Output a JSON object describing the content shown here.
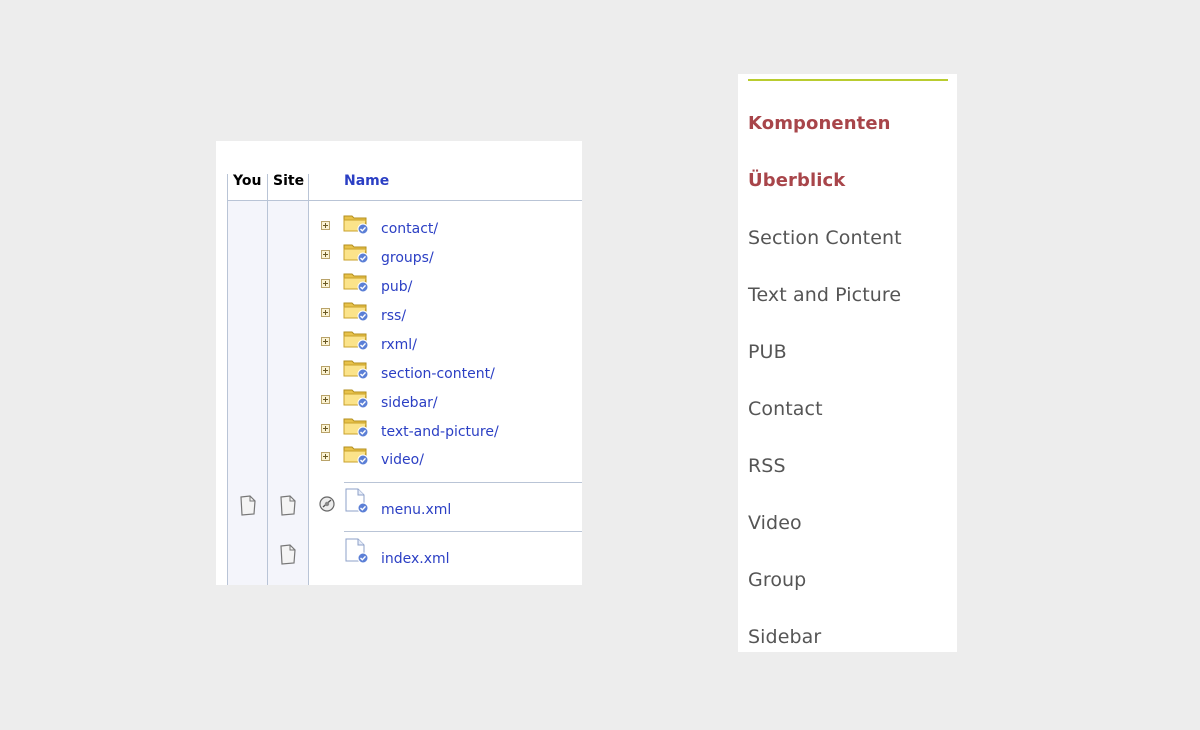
{
  "file_browser": {
    "headers": {
      "you": "You",
      "site": "Site",
      "name": "Name"
    },
    "folders": [
      {
        "name": "contact/"
      },
      {
        "name": "groups/"
      },
      {
        "name": "pub/"
      },
      {
        "name": "rss/"
      },
      {
        "name": "rxml/"
      },
      {
        "name": "section-content/"
      },
      {
        "name": "sidebar/"
      },
      {
        "name": "text-and-picture/"
      },
      {
        "name": "video/"
      }
    ],
    "files": [
      {
        "name": "menu.xml",
        "you_icon": "page-icon",
        "site_icon": "page-icon",
        "status_icon": "eye-icon"
      },
      {
        "name": "index.xml",
        "site_icon": "page-icon"
      }
    ]
  },
  "nav": {
    "items": [
      {
        "label": "Komponenten",
        "active": true
      },
      {
        "label": "Überblick",
        "active": true
      },
      {
        "label": "Section Content",
        "active": false
      },
      {
        "label": "Text and Picture",
        "active": false
      },
      {
        "label": "PUB",
        "active": false
      },
      {
        "label": "Contact",
        "active": false
      },
      {
        "label": "RSS",
        "active": false
      },
      {
        "label": "Video",
        "active": false
      },
      {
        "label": "Group",
        "active": false
      },
      {
        "label": "Sidebar",
        "active": false
      }
    ],
    "accent_color": "#b9cc2f",
    "active_color": "#a8454a"
  }
}
